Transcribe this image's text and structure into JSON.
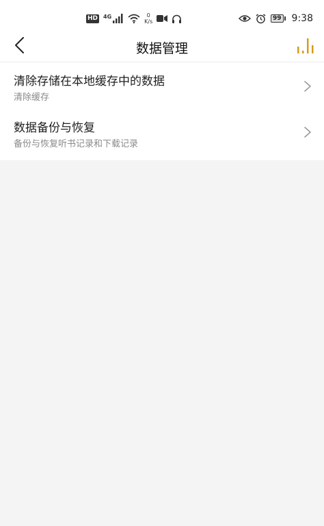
{
  "status_bar": {
    "hd_label": "HD",
    "signal_type": "4G",
    "net_speed_value": "0",
    "net_speed_unit": "K/s",
    "battery_level": "99",
    "time": "9:38"
  },
  "header": {
    "title": "数据管理",
    "back_icon": "back-arrow-icon",
    "playing_icon": "audio-bars-icon",
    "accent_color": "#d99a1c"
  },
  "settings_list": [
    {
      "title": "清除存储在本地缓存中的数据",
      "subtitle": "清除缓存"
    },
    {
      "title": "数据备份与恢复",
      "subtitle": "备份与恢复听书记录和下载记录"
    }
  ]
}
